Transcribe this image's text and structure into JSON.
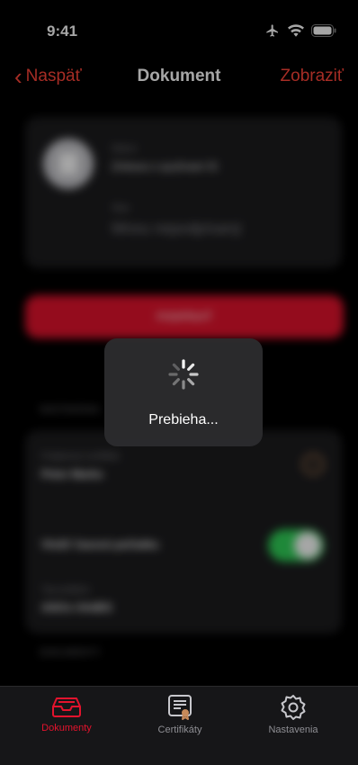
{
  "status_bar": {
    "time": "9:41"
  },
  "nav": {
    "back_label": "Naspäť",
    "title": "Dokument",
    "action_label": "Zobraziť"
  },
  "background": {
    "card1": {
      "name_label": "Názov",
      "name_value": "Zmluva o využívaní IS",
      "state_label": "Stav",
      "state_value": "Mnou nepodpísaný"
    },
    "sign_button_label": "PODPÍSAŤ",
    "settings_header": "NASTAVENIA",
    "card2": {
      "certificate_label": "Podpisový certifikát",
      "certificate_value": "Peter Marko",
      "timestamp_label": "Vložiť časovú pečiatku",
      "timestamp_enabled": true,
      "type_label": "Typ podpisu",
      "type_value": "ASiCe XAdES"
    },
    "documents_header": "DOKUMENTY"
  },
  "loading": {
    "label": "Prebieha..."
  },
  "tabs": [
    {
      "label": "Dokumenty",
      "icon": "inbox-tray-icon",
      "active": true
    },
    {
      "label": "Certifikáty",
      "icon": "certificate-icon",
      "active": false
    },
    {
      "label": "Nastavenia",
      "icon": "gear-icon",
      "active": false
    }
  ],
  "colors": {
    "accent": "#e3132d",
    "nav_tint": "#ff453a",
    "toggle_on": "#30d158",
    "background": "#000000",
    "tabbar": "#161618"
  }
}
